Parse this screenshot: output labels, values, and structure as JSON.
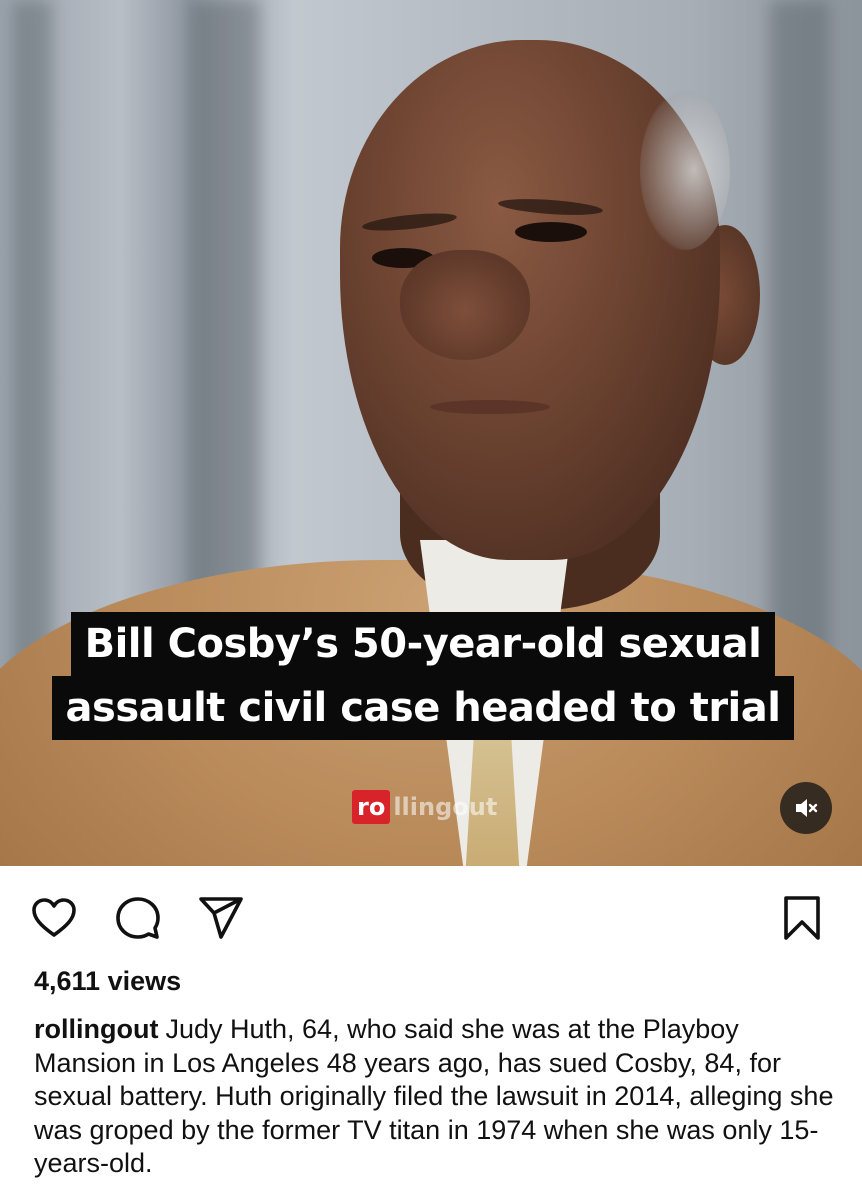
{
  "media": {
    "headline_line1": "Bill Cosby’s 50-year-old sexual",
    "headline_line2": "assault civil case headed to trial",
    "watermark_boxed": "ro",
    "watermark_rest": "llingout",
    "mute_icon": "speaker-muted-icon"
  },
  "actions": {
    "like_icon": "heart-icon",
    "comment_icon": "comment-icon",
    "share_icon": "paper-plane-icon",
    "save_icon": "bookmark-icon"
  },
  "post": {
    "views": "4,611 views",
    "username": "rollingout",
    "caption": "Judy Huth, 64, who said she was at the Playboy Mansion in Los Angeles 48 years ago, has sued Cosby, 84, for sexual battery. Huth originally filed the lawsuit in 2014, alleging she was groped by the former TV titan in 1974 when she was only 15-years-old."
  },
  "colors": {
    "watermark_red": "#d8232a",
    "headline_bg": "#0a0a0a",
    "text": "#111111"
  }
}
